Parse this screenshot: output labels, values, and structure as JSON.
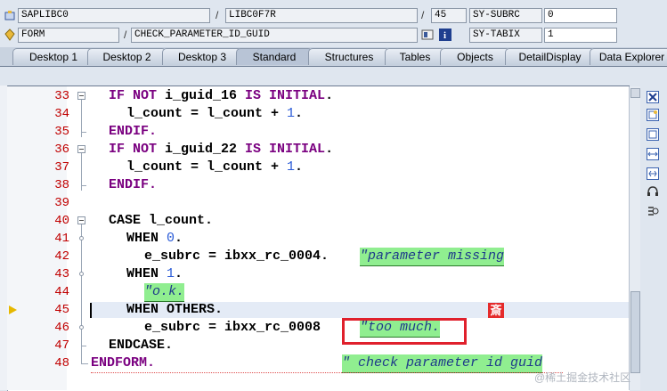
{
  "header": {
    "row1": {
      "program": "SAPLIBC0",
      "include": "LIBC0F7R",
      "line": "45",
      "sysvar": "SY-SUBRC",
      "sysval": "0"
    },
    "row2": {
      "type": "FORM",
      "name": "CHECK_PARAMETER_ID_GUID",
      "sysvar": "SY-TABIX",
      "sysval": "1"
    }
  },
  "tabs": [
    "Desktop 1",
    "Desktop 2",
    "Desktop 3",
    "Standard",
    "Structures",
    "Tables",
    "Objects",
    "DetailDisplay",
    "Data Explorer"
  ],
  "active_tab": "Standard",
  "code_lines": [
    {
      "n": "33",
      "text": "IF NOT i_guid_16 IS INITIAL."
    },
    {
      "n": "34",
      "text": "l_count = l_count + 1."
    },
    {
      "n": "35",
      "text": "ENDIF."
    },
    {
      "n": "36",
      "text": "IF NOT i_guid_22 IS INITIAL."
    },
    {
      "n": "37",
      "text": "l_count = l_count + 1."
    },
    {
      "n": "38",
      "text": "ENDIF."
    },
    {
      "n": "39",
      "text": ""
    },
    {
      "n": "40",
      "text": "CASE l_count."
    },
    {
      "n": "41",
      "text": "WHEN 0."
    },
    {
      "n": "42",
      "text": "e_subrc = ibxx_rc_0004.",
      "comment": "\"parameter missing"
    },
    {
      "n": "43",
      "text": "WHEN 1."
    },
    {
      "n": "44",
      "text": "",
      "comment": "\"o.k."
    },
    {
      "n": "45",
      "text": "WHEN OTHERS."
    },
    {
      "n": "46",
      "text": "e_subrc = ibxx_rc_0008",
      "comment": "\"too much."
    },
    {
      "n": "47",
      "text": "ENDCASE."
    },
    {
      "n": "48",
      "text": "ENDFORM.",
      "comment": "\" check parameter id guid"
    }
  ],
  "badge_text": "斎",
  "watermark": "@稀土掘金技术社区",
  "icons": [
    "program-icon",
    "form-icon",
    "info-icon",
    "close-icon",
    "new-icon",
    "fullscreen-icon",
    "resize-icon",
    "headset-icon",
    "settings-icon"
  ]
}
